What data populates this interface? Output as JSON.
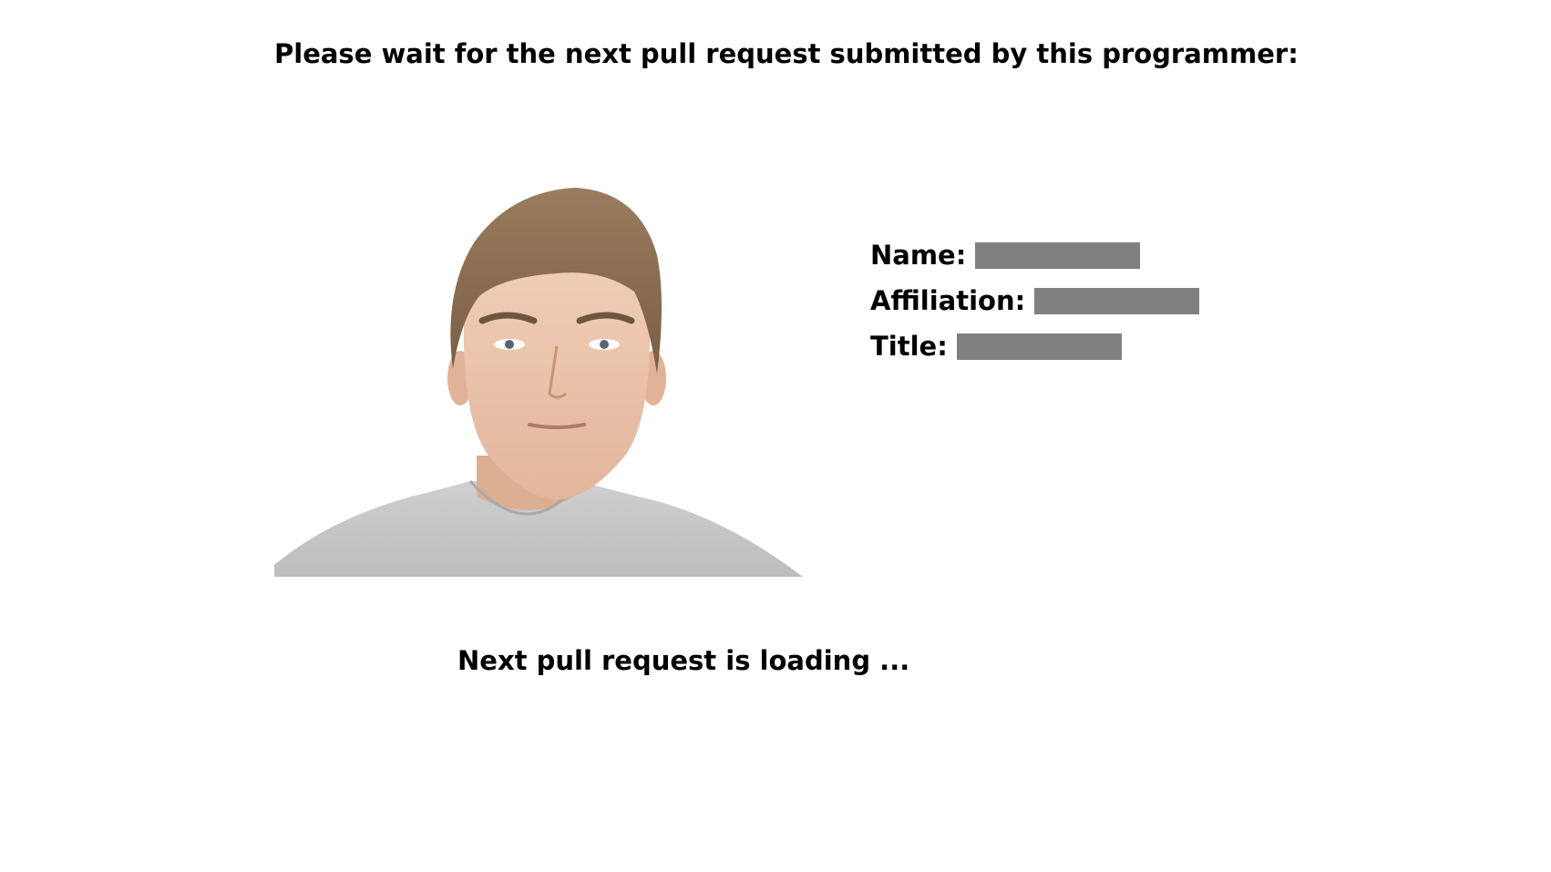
{
  "header": {
    "instruction": "Please wait for the next pull request submitted by this programmer:"
  },
  "profile": {
    "photo": "programmer-portrait",
    "fields": [
      {
        "label": "Name:",
        "value": "redacted"
      },
      {
        "label": "Affiliation:",
        "value": "redacted"
      },
      {
        "label": "Title:",
        "value": "redacted"
      }
    ]
  },
  "status": {
    "loading_text": "Next pull request is loading ..."
  },
  "colors": {
    "redaction_bar": "#808080",
    "background": "#ffffff",
    "shirt": "#c4c4c4",
    "skin": "#e8c0a8",
    "hair": "#8a6e52"
  }
}
